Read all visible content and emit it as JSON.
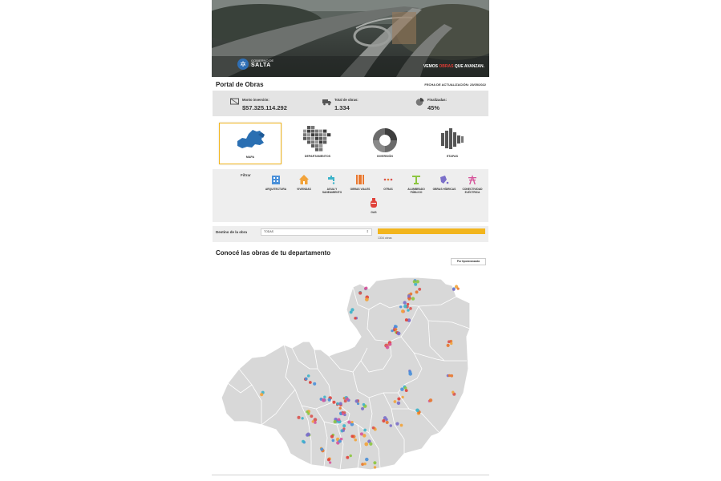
{
  "hero": {
    "logo_line1": "GOBIERNO DE",
    "logo_line2": "SALTA",
    "tagline_pre": "VEMOS ",
    "tagline_hl": "OBRAS",
    "tagline_post": " QUE AVANZAN."
  },
  "header": {
    "title": "Portal de Obras",
    "update": "FECHA DE ACTUALIZACIÓN: 23/05/2022"
  },
  "stats": [
    {
      "label": "Monto inversión:",
      "value": "$57.325.114.292",
      "icon": "money-icon"
    },
    {
      "label": "Total de obras:",
      "value": "1.334",
      "icon": "truck-icon"
    },
    {
      "label": "Finalizadas:",
      "value": "45%",
      "icon": "pie-icon"
    }
  ],
  "views": [
    {
      "label": "MAPA",
      "icon": "map-icon",
      "active": true
    },
    {
      "label": "DEPARTAMENTOS",
      "icon": "grid-icon",
      "active": false
    },
    {
      "label": "INVERSIÓN",
      "icon": "donut-icon",
      "active": false
    },
    {
      "label": "ETAPAS",
      "icon": "stages-icon",
      "active": false
    }
  ],
  "filter": {
    "label": "Filtrar",
    "items": [
      {
        "label": "ARQUITECTURA",
        "icon": "building-icon",
        "color": "#4a90d9"
      },
      {
        "label": "VIVIENDAS",
        "icon": "house-icon",
        "color": "#f2a33a"
      },
      {
        "label": "AGUA Y SANEAMIENTO",
        "icon": "faucet-icon",
        "color": "#3cb3c9"
      },
      {
        "label": "OBRAS VIALES",
        "icon": "road-icon",
        "color": "#e8772e"
      },
      {
        "label": "OTRAS",
        "icon": "dots-icon",
        "color": "#d9534f"
      },
      {
        "label": "ALUMBRADO PÚBLICO",
        "icon": "streetlight-icon",
        "color": "#8cc63f"
      },
      {
        "label": "OBRAS HÍDRICAS",
        "icon": "water-icon",
        "color": "#7b6fc9"
      },
      {
        "label": "CONECTIVIDAD ELÉCTRICA",
        "icon": "tower-icon",
        "color": "#d6549b"
      },
      {
        "label": "GAS",
        "icon": "gas-icon",
        "color": "#e0413a"
      }
    ]
  },
  "destino": {
    "label": "Destino de la obra",
    "select_value": "TODAS",
    "count": "1334 obras",
    "progress": 1.0
  },
  "map_section": {
    "title": "Conocé las obras de tu departamento",
    "button": "Por tipo/avanzada"
  },
  "colors": {
    "accent": "#f2b51d",
    "panel": "#e4e4e4",
    "map_fill": "#d8d8d8"
  }
}
